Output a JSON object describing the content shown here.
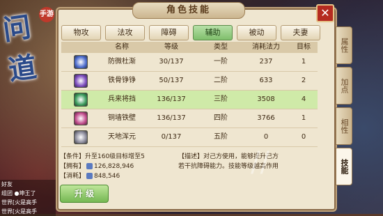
{
  "game": {
    "logo_text": "问道",
    "logo_badge": "手游"
  },
  "dialog": {
    "title": "角色技能",
    "close": "✕"
  },
  "tabs": [
    {
      "label": "物攻"
    },
    {
      "label": "法攻"
    },
    {
      "label": "障碍"
    },
    {
      "label": "辅助",
      "active": true
    },
    {
      "label": "被动"
    },
    {
      "label": "夫妻"
    }
  ],
  "table": {
    "headers": [
      "名称",
      "等级",
      "类型",
      "消耗法力",
      "目标"
    ],
    "rows": [
      {
        "icon": "skill-icon-blue",
        "color": "#4a6acc",
        "name": "防微杜渐",
        "level": "30/137",
        "type": "一阶",
        "cost": "237",
        "target": "1"
      },
      {
        "icon": "skill-icon-purple",
        "color": "#7a4abc",
        "name": "铁骨铮铮",
        "level": "50/137",
        "type": "二阶",
        "cost": "633",
        "target": "2"
      },
      {
        "icon": "skill-icon-green",
        "color": "#3a9a5a",
        "name": "兵来将挡",
        "level": "136/137",
        "type": "三阶",
        "cost": "3508",
        "target": "4",
        "selected": true
      },
      {
        "icon": "skill-icon-pink",
        "color": "#c04a8a",
        "name": "铜墙铁壁",
        "level": "136/137",
        "type": "四阶",
        "cost": "3766",
        "target": "1"
      },
      {
        "icon": "skill-icon-white",
        "color": "#8a8a9a",
        "name": "天地浑元",
        "level": "0/137",
        "type": "五阶",
        "cost": "0",
        "target": "0"
      }
    ]
  },
  "info": {
    "condition": "【条件】升至160级目标增至5",
    "owned_label": "【拥有】",
    "owned_value": "126,828,946",
    "consume_label": "【消耗】",
    "consume_value": "848,546"
  },
  "description": {
    "line1": "【描述】对己方使用，能够提升己方",
    "line2": "若干抗障碍能力。技能等级越高作用"
  },
  "upgrade_button": "升 级",
  "side_tabs": [
    {
      "label": "属性"
    },
    {
      "label": "加点"
    },
    {
      "label": "相性"
    },
    {
      "label": "技能",
      "active": true
    }
  ],
  "chat": [
    "好友",
    "组团 ●坤王了",
    "世界[火是高手",
    "世界[火是高手"
  ],
  "watermark": "//"
}
